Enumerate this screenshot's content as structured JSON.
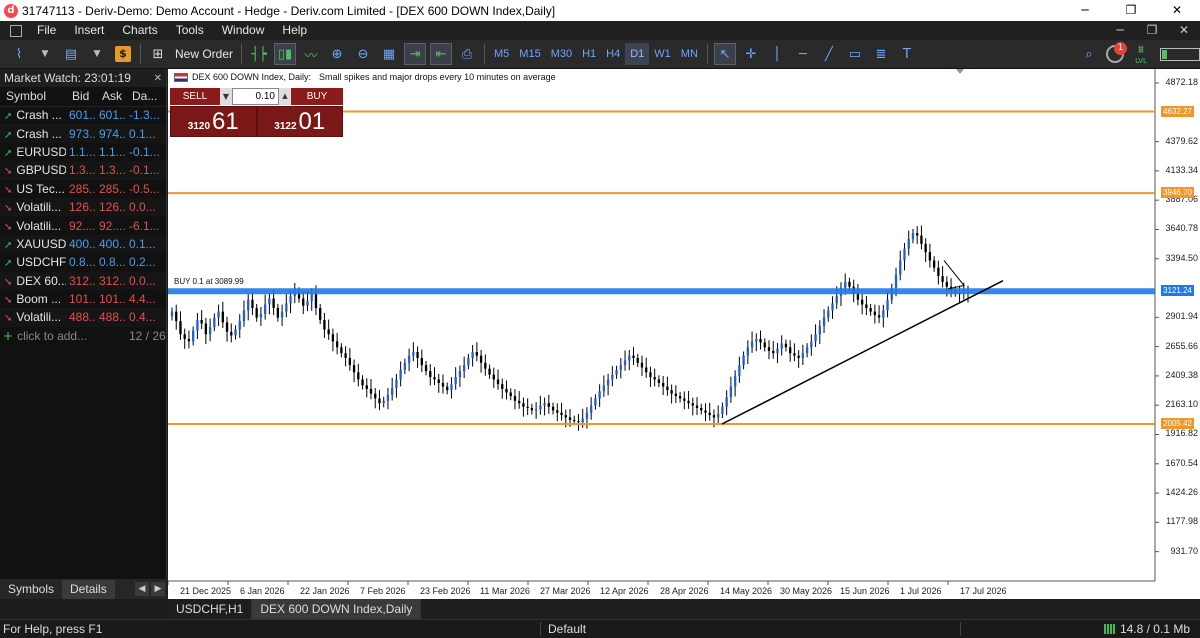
{
  "window": {
    "title": "31747113 - Deriv-Demo: Demo Account - Hedge - Deriv.com Limited - [DEX 600 DOWN Index,Daily]",
    "app_icon_letter": "d"
  },
  "menu": [
    "File",
    "Insert",
    "Charts",
    "Tools",
    "Window",
    "Help"
  ],
  "toolbar": {
    "new_order_label": "New Order",
    "timeframes": [
      "M5",
      "M15",
      "M30",
      "H1",
      "H4",
      "D1",
      "W1",
      "MN"
    ],
    "active_timeframe": "D1",
    "notification_count": "1",
    "level_label": "LVL"
  },
  "market_watch": {
    "title": "Market Watch: 23:01:19",
    "columns": [
      "Symbol",
      "Bid",
      "Ask",
      "Da..."
    ],
    "rows": [
      {
        "symbol": "Crash ...",
        "bid": "601...",
        "ask": "601...",
        "daily": "-1.3...",
        "dir": "up"
      },
      {
        "symbol": "Crash ...",
        "bid": "973...",
        "ask": "974...",
        "daily": "0.1...",
        "dir": "up"
      },
      {
        "symbol": "EURUSD",
        "bid": "1.1...",
        "ask": "1.1...",
        "daily": "-0.1...",
        "dir": "up"
      },
      {
        "symbol": "GBPUSD",
        "bid": "1.3...",
        "ask": "1.3...",
        "daily": "-0.1...",
        "dir": "down"
      },
      {
        "symbol": "US Tec...",
        "bid": "285...",
        "ask": "285...",
        "daily": "-0.5...",
        "dir": "down"
      },
      {
        "symbol": "Volatili...",
        "bid": "126...",
        "ask": "126...",
        "daily": "0.0...",
        "dir": "down"
      },
      {
        "symbol": "Volatili...",
        "bid": "92....",
        "ask": "92....",
        "daily": "-6.1...",
        "dir": "down"
      },
      {
        "symbol": "XAUUSD",
        "bid": "400...",
        "ask": "400...",
        "daily": "0.1...",
        "dir": "up"
      },
      {
        "symbol": "USDCHF",
        "bid": "0.8...",
        "ask": "0.8...",
        "daily": "0.2...",
        "dir": "up"
      },
      {
        "symbol": "DEX 60...",
        "bid": "312...",
        "ask": "312...",
        "daily": "0.0...",
        "dir": "down"
      },
      {
        "symbol": "Boom ...",
        "bid": "101...",
        "ask": "101...",
        "daily": "4.4...",
        "dir": "down"
      },
      {
        "symbol": "Volatili...",
        "bid": "488...",
        "ask": "488...",
        "daily": "0.4...",
        "dir": "down"
      }
    ],
    "add_label": "click to add...",
    "count_label": "12 / 263",
    "tabs": [
      "Symbols",
      "Details"
    ],
    "active_tab": "Details"
  },
  "chart": {
    "caption_symbol": "DEX 600 DOWN Index, Daily:",
    "caption_desc": "Small spikes and major drops every 10 minutes on average",
    "one_click": {
      "sell_label": "SELL",
      "buy_label": "BUY",
      "volume": "0.10",
      "sell_price_small": "3120",
      "sell_price_big": "61",
      "buy_price_small": "3122",
      "buy_price_big": "01"
    },
    "buy_position_label": "BUY 0.1 at 3089.99",
    "tabs": [
      "USDCHF,H1",
      "DEX 600 DOWN Index,Daily"
    ],
    "active_tab": "DEX 600 DOWN Index,Daily"
  },
  "chart_data": {
    "type": "candlestick",
    "title": "DEX 600 DOWN Index, Daily",
    "y_ticks": [
      "4872.18",
      "4379.62",
      "4133.34",
      "3887.06",
      "3640.78",
      "3394.50",
      "2901.94",
      "2655.66",
      "2409.38",
      "2163.10",
      "1916.82",
      "1670.54",
      "1424.26",
      "1177.98",
      "931.70"
    ],
    "y_tick_values": [
      4872.18,
      4379.62,
      4133.34,
      3887.06,
      3640.78,
      3394.5,
      2901.94,
      2655.66,
      2409.38,
      2163.1,
      1916.82,
      1670.54,
      1424.26,
      1177.98,
      931.7
    ],
    "ylim": [
      685,
      4990
    ],
    "x_ticks": [
      "21 Dec 2025",
      "6 Jan 2026",
      "22 Jan 2026",
      "7 Feb 2026",
      "23 Feb 2026",
      "11 Mar 2026",
      "27 Mar 2026",
      "12 Apr 2026",
      "28 Apr 2026",
      "14 May 2026",
      "30 May 2026",
      "15 Jun 2026",
      "1 Jul 2026",
      "17 Jul 2026"
    ],
    "horizontal_levels": [
      {
        "value": 4632.27,
        "label": "4632.27",
        "color": "#f0962b"
      },
      {
        "value": 3946.7,
        "label": "3946.70",
        "color": "#f0962b"
      },
      {
        "value": 3121.24,
        "label": "3121.24",
        "color": "#1e7ae6"
      },
      {
        "value": 2005.42,
        "label": "2005.42",
        "color": "#f0962b"
      }
    ],
    "trendline": {
      "from": [
        "14 May 2026",
        2005
      ],
      "to": [
        "22 Jul 2026",
        3210
      ]
    },
    "colors": {
      "bull": "#1e5fe0",
      "bear": "#000000",
      "wick": "#000000"
    },
    "closes": [
      2950,
      2870,
      2760,
      2720,
      2700,
      2790,
      2880,
      2850,
      2760,
      2820,
      2900,
      2950,
      2860,
      2780,
      2750,
      2800,
      2870,
      2960,
      3050,
      2980,
      2900,
      2930,
      3010,
      3060,
      2980,
      2900,
      2950,
      3020,
      3080,
      3120,
      3060,
      3000,
      3040,
      3100,
      2980,
      2880,
      2800,
      2760,
      2700,
      2650,
      2600,
      2560,
      2500,
      2440,
      2380,
      2330,
      2300,
      2260,
      2220,
      2180,
      2200,
      2250,
      2310,
      2380,
      2460,
      2520,
      2580,
      2610,
      2560,
      2500,
      2450,
      2400,
      2380,
      2350,
      2320,
      2290,
      2340,
      2400,
      2450,
      2500,
      2560,
      2610,
      2580,
      2520,
      2470,
      2420,
      2380,
      2340,
      2300,
      2270,
      2240,
      2200,
      2180,
      2150,
      2140,
      2120,
      2130,
      2160,
      2180,
      2150,
      2120,
      2100,
      2080,
      2060,
      2040,
      2030,
      2020,
      2050,
      2100,
      2160,
      2220,
      2280,
      2330,
      2380,
      2420,
      2460,
      2500,
      2540,
      2580,
      2560,
      2520,
      2480,
      2440,
      2400,
      2380,
      2350,
      2320,
      2290,
      2260,
      2240,
      2220,
      2200,
      2180,
      2160,
      2140,
      2120,
      2100,
      2080,
      2060,
      2090,
      2150,
      2230,
      2320,
      2410,
      2500,
      2580,
      2650,
      2700,
      2720,
      2690,
      2650,
      2620,
      2600,
      2640,
      2680,
      2650,
      2600,
      2580,
      2560,
      2600,
      2650,
      2700,
      2760,
      2830,
      2900,
      2960,
      3020,
      3080,
      3150,
      3200,
      3160,
      3100,
      3050,
      3010,
      2980,
      2950,
      2920,
      2900,
      2960,
      3050,
      3150,
      3260,
      3380,
      3480,
      3560,
      3610,
      3590,
      3520,
      3450,
      3380,
      3320,
      3250,
      3200,
      3160,
      3130,
      3110,
      3100,
      3110,
      3120
    ]
  }
}
